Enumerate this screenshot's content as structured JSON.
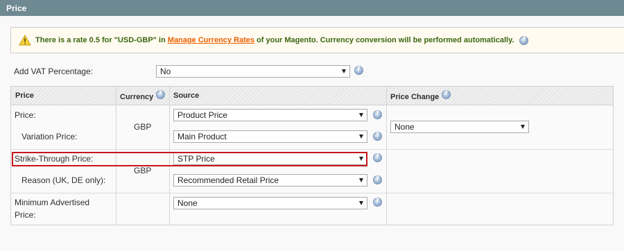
{
  "header": {
    "title": "Price"
  },
  "notice": {
    "text_before": "There is a rate 0.5 for \"USD-GBP\" in",
    "link": "Manage Currency Rates",
    "text_after": "of your Magento. Currency conversion will be performed automatically.",
    "icon": "warning-icon",
    "warning_color": "#f1c40f"
  },
  "vat": {
    "label": "Add VAT Percentage:",
    "value": "No"
  },
  "table": {
    "columns": {
      "price": "Price",
      "currency": "Currency",
      "source": "Source",
      "price_change": "Price Change"
    },
    "rows": {
      "price": {
        "label": "Price:",
        "source": "Product Price"
      },
      "variation": {
        "label": "Variation Price:",
        "source": "Main Product"
      },
      "currency_1": "GBP",
      "price_change": "None",
      "strike": {
        "label": "Strike-Through Price:",
        "source": "STP Price"
      },
      "reason": {
        "label": "Reason (UK, DE only):",
        "source": "Recommended Retail Price"
      },
      "currency_2": "GBP",
      "map": {
        "label_line1": "Minimum Advertised",
        "label_line2": "Price:",
        "source": "None"
      }
    }
  },
  "colors": {
    "header_bg": "#6f8992",
    "highlight": "#c7161c",
    "link": "#eb5e00",
    "notice_text": "#3d6611"
  }
}
